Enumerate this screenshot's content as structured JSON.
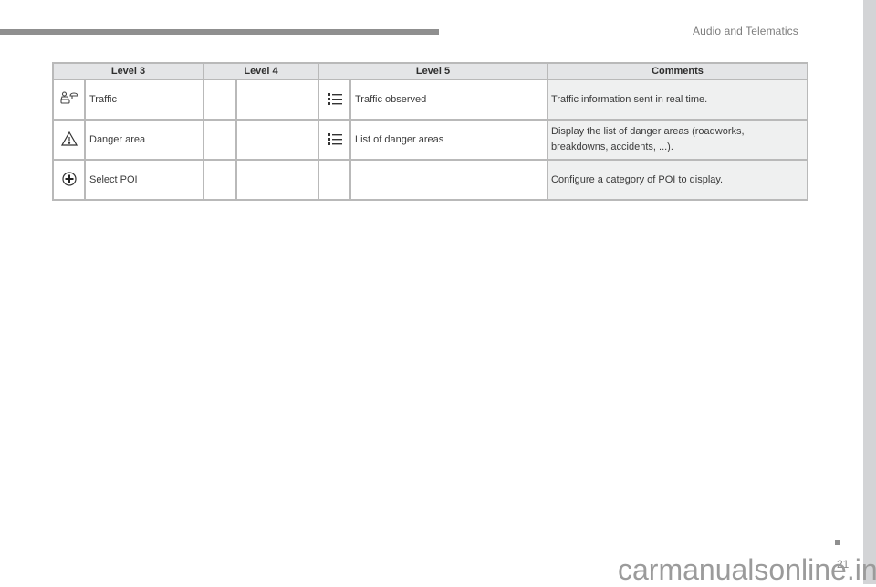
{
  "header": {
    "section_title": "Audio and Telematics"
  },
  "table": {
    "columns": [
      "Level 3",
      "Level 4",
      "Level 5",
      "Comments"
    ],
    "rows": [
      {
        "level3_icon": "traffic-icon",
        "level3_label": "Traffic",
        "level4_label": "",
        "level5_icon": "list-icon",
        "level5_label": "Traffic observed",
        "comment": "Traffic information sent in real time."
      },
      {
        "level3_icon": "warning-triangle-icon",
        "level3_label": "Danger area",
        "level4_label": "",
        "level5_icon": "list-icon",
        "level5_label": "List of danger areas",
        "comment": "Display the list of danger areas (roadworks, breakdowns, accidents, ...)."
      },
      {
        "level3_icon": "plus-circle-icon",
        "level3_label": "Select POI",
        "level4_label": "",
        "level5_icon": "",
        "level5_label": "",
        "comment": "Configure a category of POI to display."
      }
    ]
  },
  "footer": {
    "page_number": "21",
    "watermark": "carmanualsonline.info"
  }
}
